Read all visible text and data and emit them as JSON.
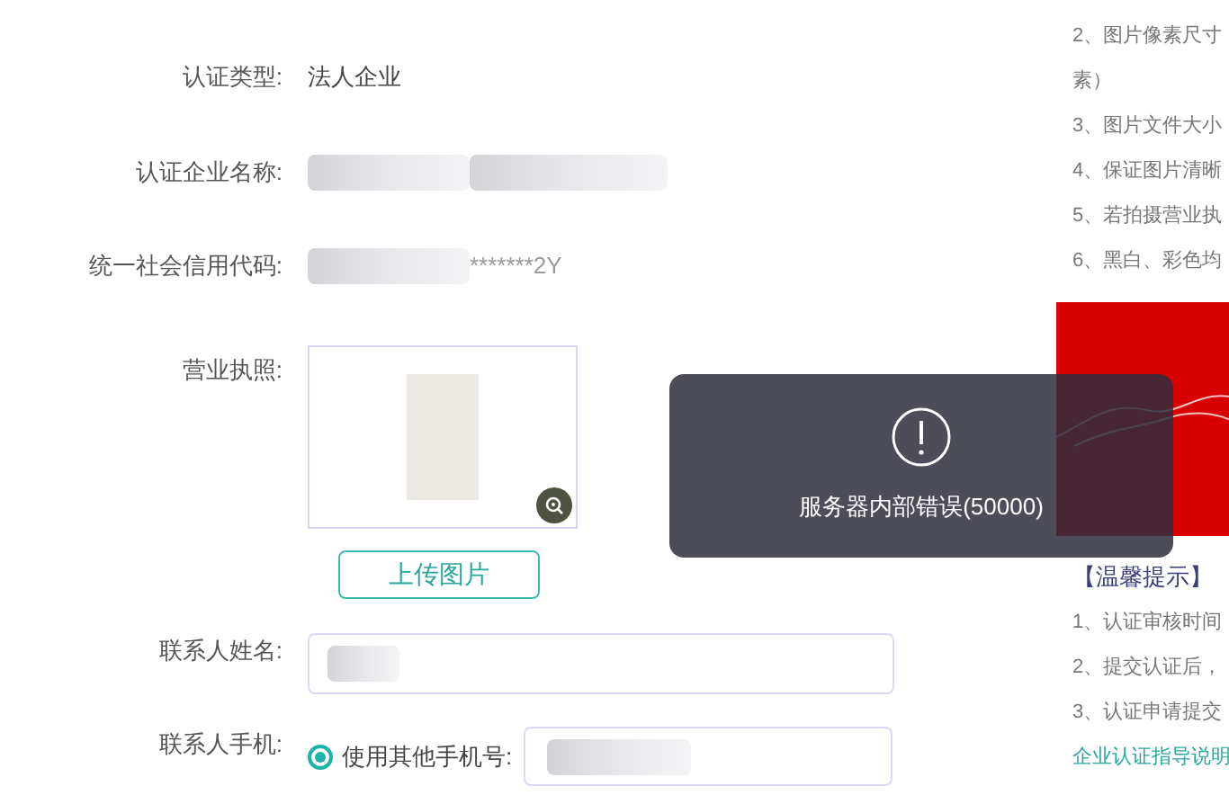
{
  "form": {
    "rows": [
      {
        "kind": "text",
        "label": "认证类型:",
        "value": "法人企业"
      },
      {
        "kind": "redacted",
        "label": "认证企业名称:"
      },
      {
        "kind": "redacted",
        "label": "统一社会信用代码:",
        "value": "*******2Y"
      },
      {
        "kind": "image",
        "label": "营业执照:",
        "button": "上传图片"
      },
      {
        "kind": "input",
        "label": "联系人姓名:"
      },
      {
        "kind": "phone",
        "label": "联系人手机:",
        "option": "使用其他手机号:",
        "selected": true
      }
    ]
  },
  "tips": {
    "lines": [
      "2、图片像素尺寸",
      "素）",
      "3、图片文件大小",
      "4、保证图片清晰",
      "5、若拍摄营业执",
      "6、黑白、彩色均"
    ],
    "notice_title": "【温馨提示】",
    "notice_lines": [
      "1、认证审核时间",
      "2、提交认证后，",
      "3、认证申请提交"
    ],
    "link": "企业认证指导说明"
  },
  "toast": {
    "message": "服务器内部错误(50000)"
  }
}
